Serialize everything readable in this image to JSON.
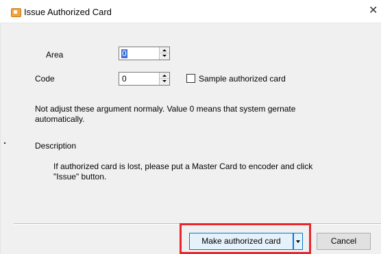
{
  "window": {
    "title": "Issue Authorized Card",
    "close_glyph": "✕",
    "icon": "app-icon"
  },
  "form": {
    "area_label": "Area",
    "area_value": "0",
    "code_label": "Code",
    "code_value": "0",
    "sample_checkbox_label": "Sample authorized card",
    "sample_checked": false
  },
  "note": {
    "line1": "Not adjust these argument normaly. Value 0 means that system gernate",
    "line2": "automatically."
  },
  "description": {
    "heading": "Description",
    "line1": "If authorized card is lost,  please put a Master Card to encoder and click",
    "line2": "\"Issue\" button."
  },
  "buttons": {
    "make_label": "Make  authorized card",
    "cancel_label": "Cancel"
  },
  "colors": {
    "highlight": "#e8262c",
    "focus_border": "#0078d7",
    "selection": "#3d6fd6"
  }
}
